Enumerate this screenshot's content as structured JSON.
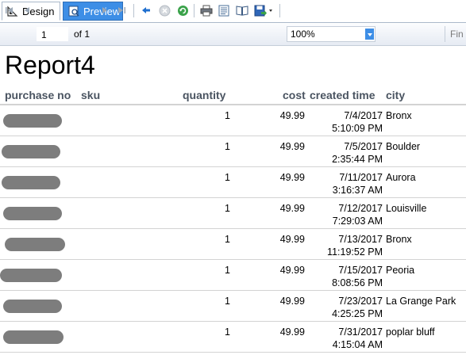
{
  "tabs": [
    {
      "label": "Design",
      "icon": "design-icon"
    },
    {
      "label": "Preview",
      "icon": "preview-icon"
    }
  ],
  "toolbar": {
    "page_value": "1",
    "of_label": "of 1",
    "zoom_value": "100%",
    "find_label": "Fin"
  },
  "report": {
    "title": "Report4",
    "columns": [
      "purchase no",
      "sku",
      "quantity",
      "cost",
      "created time",
      "city"
    ],
    "rows": [
      {
        "quantity": "1",
        "cost": "49.99",
        "date": "7/4/2017",
        "time": "5:10:09 PM",
        "city": "Bronx"
      },
      {
        "quantity": "1",
        "cost": "49.99",
        "date": "7/5/2017",
        "time": "2:35:44 PM",
        "city": "Boulder"
      },
      {
        "quantity": "1",
        "cost": "49.99",
        "date": "7/11/2017",
        "time": "3:16:37 AM",
        "city": "Aurora"
      },
      {
        "quantity": "1",
        "cost": "49.99",
        "date": "7/12/2017",
        "time": "7:29:03 AM",
        "city": "Louisville"
      },
      {
        "quantity": "1",
        "cost": "49.99",
        "date": "7/13/2017",
        "time": "11:19:52 PM",
        "city": "Bronx"
      },
      {
        "quantity": "1",
        "cost": "49.99",
        "date": "7/15/2017",
        "time": "8:08:56 PM",
        "city": "Peoria"
      },
      {
        "quantity": "1",
        "cost": "49.99",
        "date": "7/23/2017",
        "time": "4:25:25 PM",
        "city": "La Grange Park"
      },
      {
        "quantity": "1",
        "cost": "49.99",
        "date": "7/31/2017",
        "time": "4:15:04 AM",
        "city": "poplar bluff"
      }
    ]
  },
  "colors": {
    "accent": "#3d8ee6",
    "header_text": "#4a5461",
    "redaction": "#7d7d7d"
  }
}
